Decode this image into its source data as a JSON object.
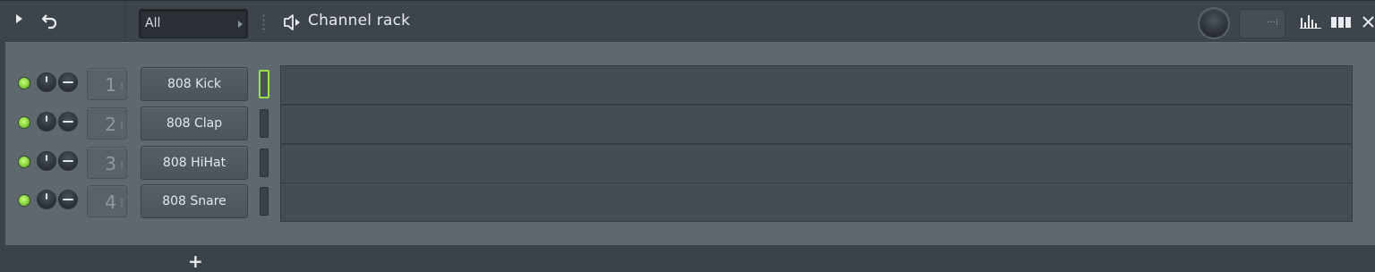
{
  "window": {
    "title": "Channel rack",
    "filter_value": "All"
  },
  "channels": [
    {
      "number": "1",
      "name": "808 Kick",
      "selected": true
    },
    {
      "number": "2",
      "name": "808 Clap",
      "selected": false
    },
    {
      "number": "3",
      "name": "808 HiHat",
      "selected": false
    },
    {
      "number": "4",
      "name": "808 Snare",
      "selected": false
    }
  ],
  "footer": {
    "add_label": "+"
  },
  "colors": {
    "led_on": "#84d23c",
    "select_on": "#9be04a",
    "panel": "#5f686f",
    "titlebar": "#3d444b"
  },
  "icons": [
    "play-icon",
    "undo-icon",
    "speaker-icon",
    "graph-icon",
    "piano-roll-icon",
    "close-icon"
  ]
}
